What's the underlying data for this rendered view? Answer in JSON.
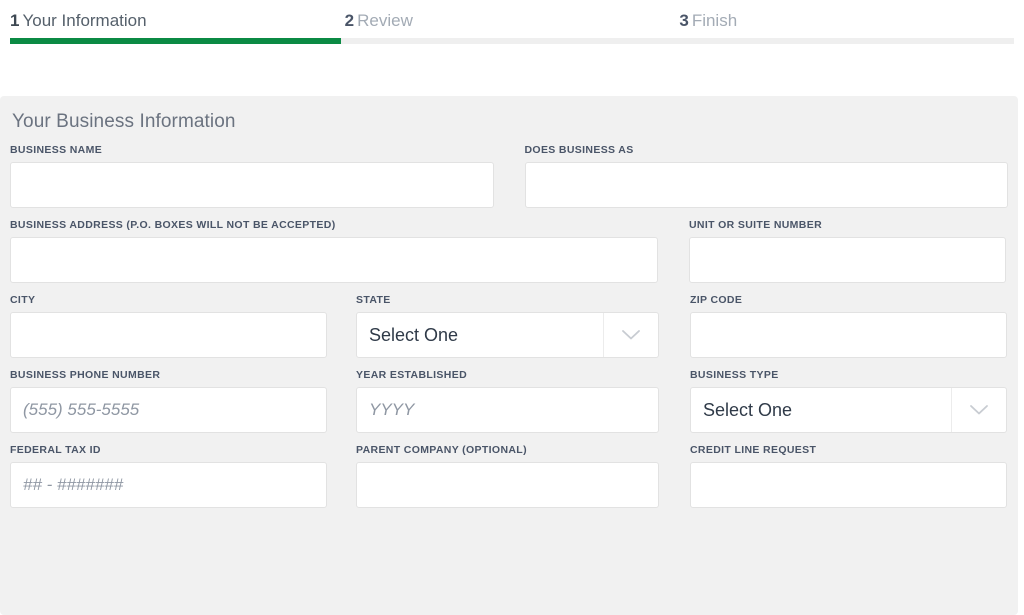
{
  "wizard": {
    "steps": [
      {
        "number": "1",
        "label": "Your Information",
        "state": "active"
      },
      {
        "number": "2",
        "label": "Review",
        "state": "inactive"
      },
      {
        "number": "3",
        "label": "Finish",
        "state": "inactive"
      }
    ],
    "progress_percent": 33,
    "active_color": "#0b8a44",
    "track_color": "#efefef"
  },
  "panel": {
    "title": "Your Business Information",
    "background": "#f1f1f1"
  },
  "form": {
    "rows": [
      {
        "fields": [
          {
            "label": "BUSINESS NAME",
            "type": "text",
            "value": "",
            "placeholder": ""
          },
          {
            "label": "DOES BUSINESS AS",
            "type": "text",
            "value": "",
            "placeholder": ""
          }
        ]
      },
      {
        "fields": [
          {
            "label": "BUSINESS ADDRESS (P.O. BOXES WILL NOT BE ACCEPTED)",
            "type": "text",
            "value": "",
            "placeholder": ""
          },
          {
            "label": "UNIT OR SUITE NUMBER",
            "type": "text",
            "value": "",
            "placeholder": ""
          }
        ]
      },
      {
        "fields": [
          {
            "label": "CITY",
            "type": "text",
            "value": "",
            "placeholder": ""
          },
          {
            "label": "STATE",
            "type": "select",
            "value": "Select One",
            "icon": "chevron-down-icon"
          },
          {
            "label": "ZIP CODE",
            "type": "text",
            "value": "",
            "placeholder": ""
          }
        ]
      },
      {
        "fields": [
          {
            "label": "BUSINESS PHONE NUMBER",
            "type": "text",
            "value": "",
            "placeholder": "(555) 555-5555"
          },
          {
            "label": "YEAR ESTABLISHED",
            "type": "text",
            "value": "",
            "placeholder": "YYYY"
          },
          {
            "label": "BUSINESS TYPE",
            "type": "select",
            "value": "Select One",
            "icon": "chevron-down-icon"
          }
        ]
      },
      {
        "fields": [
          {
            "label": "FEDERAL TAX ID",
            "type": "text",
            "value": "",
            "placeholder": "## - #######"
          },
          {
            "label": "PARENT COMPANY (OPTIONAL)",
            "type": "text",
            "value": "",
            "placeholder": ""
          },
          {
            "label": "CREDIT LINE REQUEST",
            "type": "text",
            "value": "",
            "placeholder": ""
          }
        ]
      }
    ]
  }
}
